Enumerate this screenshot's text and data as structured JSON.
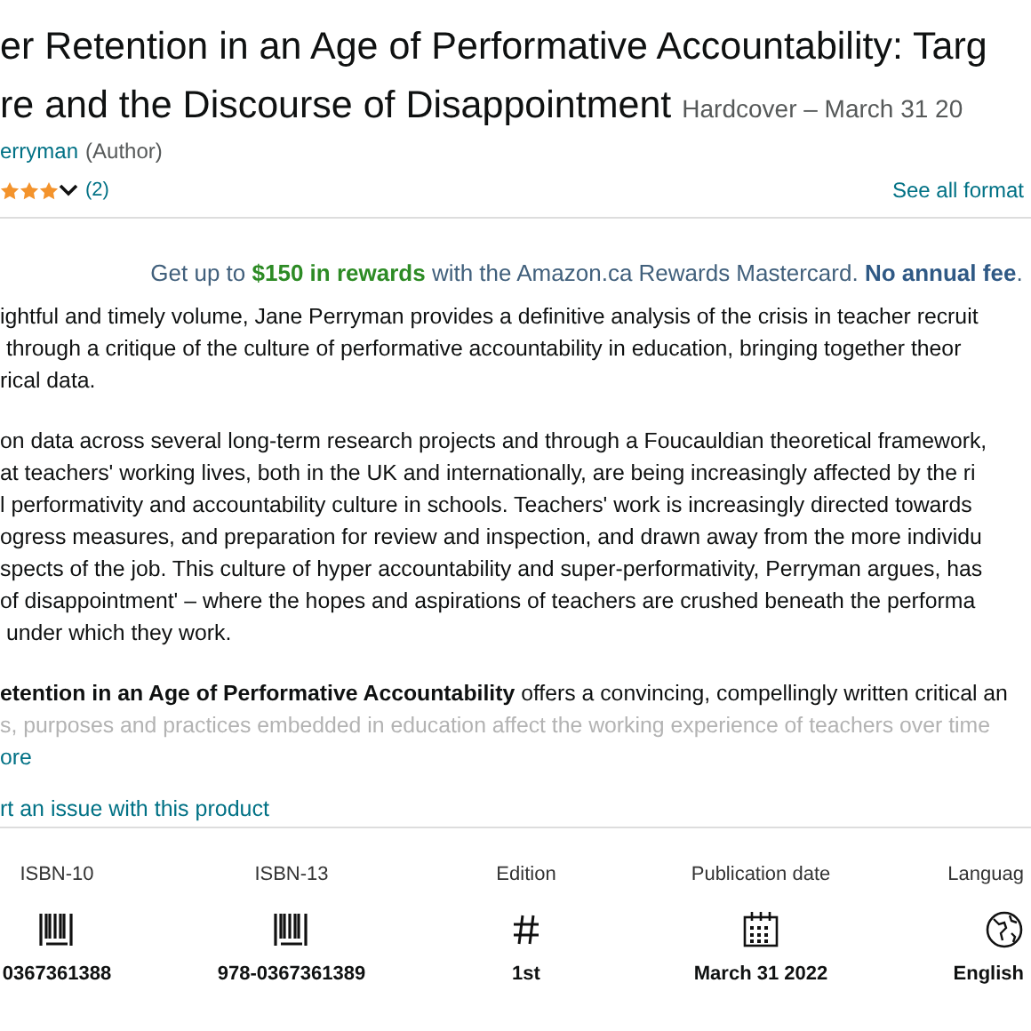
{
  "title": {
    "lines": [
      "er Retention in an Age of Performative Accountability: Targ",
      "re and the Discourse of Disappointment"
    ],
    "format": "Hardcover – March 31 20"
  },
  "author": {
    "name": "erryman",
    "role": "(Author)"
  },
  "rating": {
    "stars": 3,
    "count": "(2)",
    "formats_link": "See all format"
  },
  "promo": "Get up to **$150 in rewards** with the Amazon.ca Rewards Mastercard. **No annual fee**.",
  "description": {
    "paragraphs": [
      [
        "ightful and timely volume, Jane Perryman provides a definitive analysis of the crisis in teacher recruit",
        " through a critique of the culture of performative accountability in education, bringing together theor",
        "rical data."
      ],
      [
        "on data across several long-term research projects and through a Foucauldian theoretical framework,",
        "at teachers' working lives, both in the UK and internationally, are being increasingly affected by the ri",
        "l performativity and accountability culture in schools. Teachers' work is increasingly directed towards",
        "ogress measures, and preparation for review and inspection, and drawn away from the more individu",
        "spects of the job. This culture of hyper accountability and super-performativity, Perryman argues, has",
        "of disappointment' – where the hopes and aspirations of teachers are crushed beneath the performa",
        " under which they work."
      ],
      [
        "**etention in an Age of Performative Accountability** offers a convincing, compellingly written critical an"
      ]
    ],
    "faded_line": "s, purposes and practices embedded in education affect the working experience of teachers over time",
    "more_link": "ore"
  },
  "report_link": "rt an issue with this product",
  "details": [
    {
      "label": "ISBN-10",
      "kind": "barcode",
      "value": "0367361388"
    },
    {
      "label": "ISBN-13",
      "kind": "barcode",
      "value": "978-0367361389"
    },
    {
      "label": "Edition",
      "kind": "hash",
      "value": "1st"
    },
    {
      "label": "Publication date",
      "kind": "calendar",
      "value": "March 31 2022"
    },
    {
      "label": "Languag",
      "kind": "globe",
      "value": "English"
    }
  ]
}
